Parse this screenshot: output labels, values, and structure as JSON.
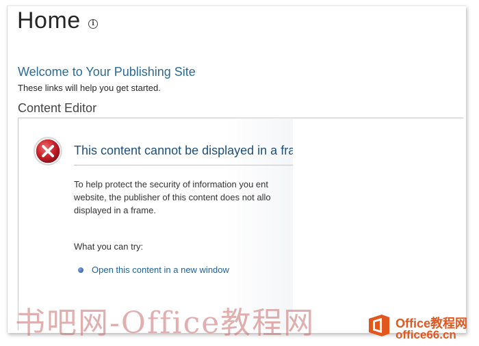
{
  "page": {
    "title": "Home",
    "info_icon": "info-icon"
  },
  "welcome": {
    "heading": "Welcome to Your Publishing Site",
    "subtitle": "These links will help you get started."
  },
  "webpart": {
    "title": "Content Editor",
    "error": {
      "icon": "error-x-icon",
      "title": "This content cannot be displayed in a fran",
      "body_lines": [
        "To help protect the security of information you ent",
        "website, the publisher of this content does not allo",
        "displayed in a frame."
      ],
      "try_label": "What you can try:",
      "actions": [
        {
          "label": "Open this content in a new window",
          "icon": "bullet-icon"
        }
      ]
    }
  },
  "watermark": {
    "left_text": "书吧网-Office教程网",
    "brand": "Office教程网",
    "domain": "office66.cn",
    "logo_icon": "office-logo-icon"
  },
  "colors": {
    "link": "#1f5f95",
    "heading": "#2a6a96",
    "error_red": "#c8202a",
    "watermark_orange": "#e2571e"
  }
}
